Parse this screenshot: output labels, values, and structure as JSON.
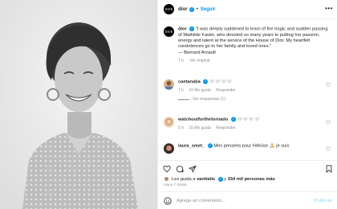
{
  "post": {
    "author": "dior",
    "follow_label": "Seguir",
    "separator": "•",
    "avatar_text": "DIOR",
    "more_label": "•••"
  },
  "caption": {
    "author": "dior",
    "text": "\"I was deeply saddened to learn of the tragic and sudden passing of Mathilde Favier, who devoted so many years to putting her passion, energy and talent at the service of the House of Dior. My heartfelt condolences go to her family and loved ones.\"",
    "signature": "— Bernard Arnault",
    "time": "7 h",
    "translate_label": "Ver original"
  },
  "comments": [
    {
      "user": "caetanaba",
      "text": "🤍🤍🤍🤍",
      "time": "7 h",
      "likes": "10 Me gusta",
      "reply_label": "Responder",
      "replies_label": "Ver respuestas (1)"
    },
    {
      "user": "watchoutforthetornado",
      "text": "🤍🤍🤍🤍",
      "time": "5 h",
      "likes": "16 Me gusta",
      "reply_label": "Responder"
    },
    {
      "user": "laura_smet_",
      "text": "Mes pensées pour Héloïse 🙏 je suis"
    }
  ],
  "actions": {
    "likes_prefix": "Les gusta a",
    "likes_user": "vanitatis",
    "likes_middle": "y",
    "likes_count": "154 mil personas más",
    "time_ago": "Hace 7 horas"
  },
  "comment_box": {
    "placeholder": "Agrega un comentario...",
    "publish_label": "Publicar"
  },
  "colors": {
    "accent": "#0095f6",
    "verified": "#0095f6",
    "secondary_text": "#8e8e8e"
  },
  "icons": [
    "heart-icon",
    "comment-icon",
    "share-icon",
    "bookmark-icon",
    "emoji-icon",
    "verified-icon",
    "more-icon"
  ]
}
